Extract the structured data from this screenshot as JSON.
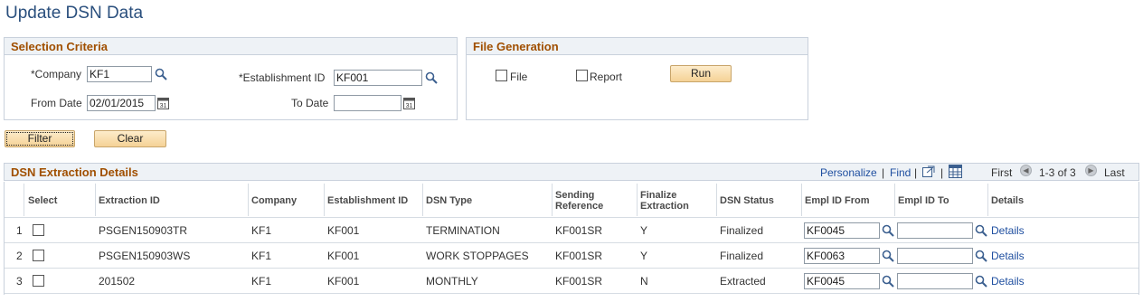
{
  "page": {
    "title": "Update DSN Data"
  },
  "selection_criteria": {
    "title": "Selection Criteria",
    "company_label": "*Company",
    "company_value": "KF1",
    "establishment_label": "*Establishment ID",
    "establishment_value": "KF001",
    "from_date_label": "From Date",
    "from_date_value": "02/01/2015",
    "to_date_label": "To Date",
    "to_date_value": ""
  },
  "file_generation": {
    "title": "File Generation",
    "file_label": "File",
    "report_label": "Report",
    "run_label": "Run"
  },
  "actions": {
    "filter_label": "Filter",
    "clear_label": "Clear"
  },
  "grid": {
    "title": "DSN Extraction Details",
    "nav": {
      "personalize": "Personalize",
      "find": "Find",
      "sep": "|",
      "first": "First",
      "range": "1-3 of 3",
      "last": "Last"
    },
    "columns": {
      "select": "Select",
      "extraction_id": "Extraction ID",
      "company": "Company",
      "establishment_id": "Establishment ID",
      "dsn_type": "DSN Type",
      "sending_reference": "Sending Reference",
      "finalize_extraction": "Finalize Extraction",
      "dsn_status": "DSN Status",
      "empl_id_from": "Empl ID From",
      "empl_id_to": "Empl ID To",
      "details": "Details"
    },
    "rows": [
      {
        "num": "1",
        "extraction_id": "PSGEN150903TR",
        "company": "KF1",
        "establishment_id": "KF001",
        "dsn_type": "TERMINATION",
        "sending_reference": "KF001SR",
        "finalize": "Y",
        "status": "Finalized",
        "empl_from": "KF0045",
        "empl_to": "",
        "details": "Details"
      },
      {
        "num": "2",
        "extraction_id": "PSGEN150903WS",
        "company": "KF1",
        "establishment_id": "KF001",
        "dsn_type": "WORK STOPPAGES",
        "sending_reference": "KF001SR",
        "finalize": "Y",
        "status": "Finalized",
        "empl_from": "KF0063",
        "empl_to": "",
        "details": "Details"
      },
      {
        "num": "3",
        "extraction_id": "201502",
        "company": "KF1",
        "establishment_id": "KF001",
        "dsn_type": "MONTHLY",
        "sending_reference": "KF001SR",
        "finalize": "N",
        "status": "Extracted",
        "empl_from": "KF0045",
        "empl_to": "",
        "details": "Details"
      }
    ]
  },
  "icons": {
    "lookup": "magnifier-icon",
    "calendar": "calendar-icon",
    "zoom": "zoom-grid-icon",
    "download": "download-excel-icon",
    "prev": "previous-arrow-icon",
    "next": "next-arrow-icon"
  }
}
